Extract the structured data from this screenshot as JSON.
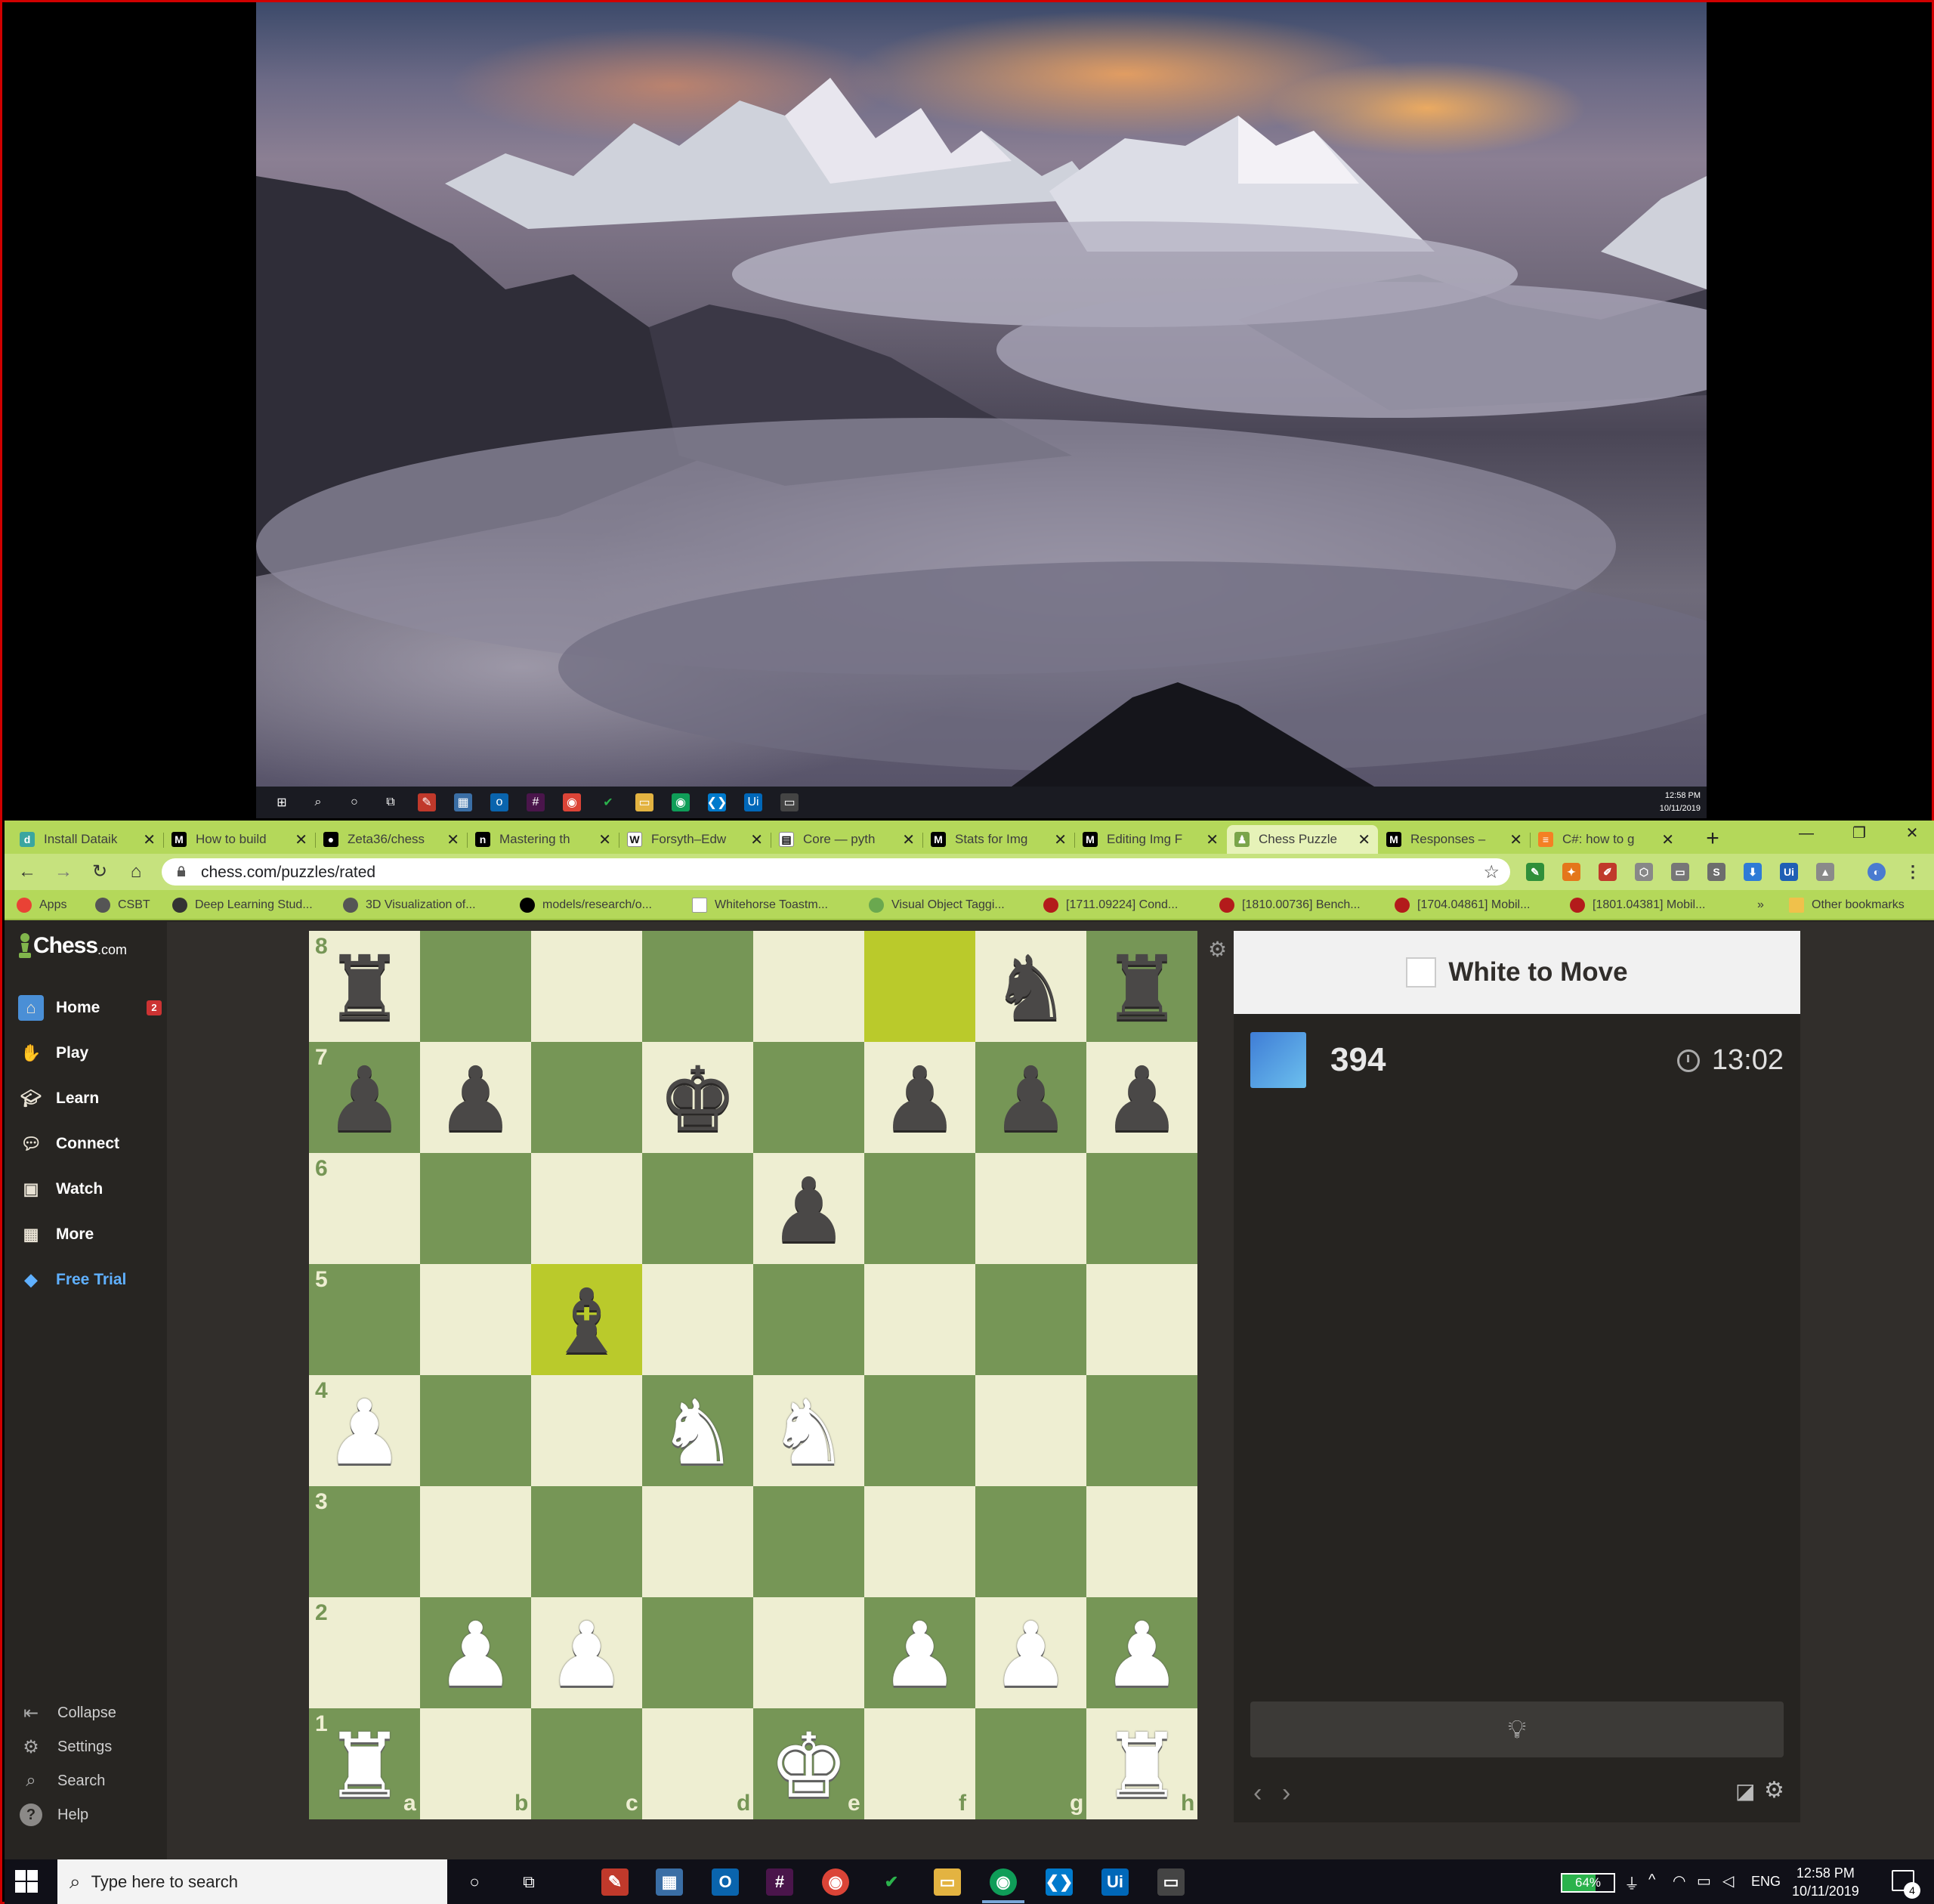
{
  "top_monitor": {
    "taskbar_clock": {
      "time": "12:58 PM",
      "date": "10/11/2019"
    }
  },
  "browser": {
    "tabs": [
      {
        "label": "Install Dataik",
        "icon": "dataiku-icon",
        "color": "#3aa6a0",
        "glyph": "d"
      },
      {
        "label": "How to build",
        "icon": "medium-icon",
        "color": "#000000",
        "glyph": "M"
      },
      {
        "label": "Zeta36/chess",
        "icon": "github-icon",
        "color": "#000000",
        "glyph": "●"
      },
      {
        "label": "Mastering th",
        "icon": "notion-icon",
        "color": "#000000",
        "glyph": "n"
      },
      {
        "label": "Forsyth–Edw",
        "icon": "wikipedia-icon",
        "color": "#ffffff",
        "glyph": "W"
      },
      {
        "label": "Core — pyth",
        "icon": "docs-icon",
        "color": "#ffffff",
        "glyph": "▤"
      },
      {
        "label": "Stats for Img",
        "icon": "medium-icon",
        "color": "#000000",
        "glyph": "M"
      },
      {
        "label": "Editing Img F",
        "icon": "medium-icon",
        "color": "#000000",
        "glyph": "M"
      },
      {
        "label": "Chess Puzzle",
        "icon": "chess-pawn-icon",
        "color": "#7aa54a",
        "glyph": "♟",
        "active": true
      },
      {
        "label": "Responses –",
        "icon": "medium-icon",
        "color": "#000000",
        "glyph": "M"
      },
      {
        "label": "C#: how to g",
        "icon": "stackoverflow-icon",
        "color": "#f48024",
        "glyph": "≡"
      }
    ],
    "new_tab": "+",
    "window_controls": {
      "minimize": "—",
      "restore": "❐",
      "close": "✕"
    },
    "url": "chess.com/puzzles/rated",
    "bookmarks": [
      {
        "label": "Apps",
        "icon": "apps-grid-icon",
        "color": "#e94235"
      },
      {
        "label": "CSBT",
        "icon": "globe-icon",
        "color": "#555555"
      },
      {
        "label": "Deep Learning Stud...",
        "icon": "brain-icon",
        "color": "#333333"
      },
      {
        "label": "3D Visualization of...",
        "icon": "globe-icon",
        "color": "#555555"
      },
      {
        "label": "models/research/o...",
        "icon": "github-icon",
        "color": "#000000"
      },
      {
        "label": "Whitehorse Toastm...",
        "icon": "fth-icon",
        "color": "#ffffff"
      },
      {
        "label": "Visual Object Taggi...",
        "icon": "tag-icon",
        "color": "#6aa84f"
      },
      {
        "label": "[1711.09224] Cond...",
        "icon": "arxiv-icon",
        "color": "#b31b1b"
      },
      {
        "label": "[1810.00736] Bench...",
        "icon": "arxiv-icon",
        "color": "#b31b1b"
      },
      {
        "label": "[1704.04861] Mobil...",
        "icon": "arxiv-icon",
        "color": "#b31b1b"
      },
      {
        "label": "[1801.04381] Mobil...",
        "icon": "arxiv-icon",
        "color": "#b31b1b"
      }
    ],
    "bookmarks_more": "»",
    "other_bookmarks": "Other bookmarks"
  },
  "sidebar": {
    "logo": {
      "main": "Chess",
      "suffix": ".com"
    },
    "items": [
      {
        "label": "Home",
        "icon": "home-icon",
        "badge": "2"
      },
      {
        "label": "Play",
        "icon": "play-icon"
      },
      {
        "label": "Learn",
        "icon": "learn-icon"
      },
      {
        "label": "Connect",
        "icon": "connect-icon"
      },
      {
        "label": "Watch",
        "icon": "watch-icon"
      },
      {
        "label": "More",
        "icon": "more-icon"
      },
      {
        "label": "Free Trial",
        "icon": "diamond-icon"
      }
    ],
    "bottom_items": [
      {
        "label": "Collapse",
        "icon": "collapse-icon"
      },
      {
        "label": "Settings",
        "icon": "gear-icon"
      },
      {
        "label": "Search",
        "icon": "search-icon"
      },
      {
        "label": "Help",
        "icon": "help-icon"
      }
    ]
  },
  "board": {
    "files": [
      "a",
      "b",
      "c",
      "d",
      "e",
      "f",
      "g",
      "h"
    ],
    "ranks": [
      "8",
      "7",
      "6",
      "5",
      "4",
      "3",
      "2",
      "1"
    ],
    "highlighted_squares": [
      "f8",
      "c5"
    ],
    "colors": {
      "light": "#eeeed2",
      "dark": "#769656",
      "highlight_light": "#f6f669",
      "highlight_dark": "#baca2b"
    },
    "pieces": [
      {
        "square": "a8",
        "color": "black",
        "type": "rook",
        "glyph": "♜"
      },
      {
        "square": "g8",
        "color": "black",
        "type": "knight",
        "glyph": "♞"
      },
      {
        "square": "h8",
        "color": "black",
        "type": "rook",
        "glyph": "♜"
      },
      {
        "square": "a7",
        "color": "black",
        "type": "pawn",
        "glyph": "♟"
      },
      {
        "square": "b7",
        "color": "black",
        "type": "pawn",
        "glyph": "♟"
      },
      {
        "square": "d7",
        "color": "black",
        "type": "king",
        "glyph": "♚"
      },
      {
        "square": "f7",
        "color": "black",
        "type": "pawn",
        "glyph": "♟"
      },
      {
        "square": "g7",
        "color": "black",
        "type": "pawn",
        "glyph": "♟"
      },
      {
        "square": "h7",
        "color": "black",
        "type": "pawn",
        "glyph": "♟"
      },
      {
        "square": "e6",
        "color": "black",
        "type": "pawn",
        "glyph": "♟"
      },
      {
        "square": "c5",
        "color": "black",
        "type": "bishop",
        "glyph": "♝"
      },
      {
        "square": "a4",
        "color": "white",
        "type": "pawn",
        "glyph": "♟"
      },
      {
        "square": "d4",
        "color": "white",
        "type": "knight",
        "glyph": "♞"
      },
      {
        "square": "e4",
        "color": "white",
        "type": "knight",
        "glyph": "♞"
      },
      {
        "square": "b2",
        "color": "white",
        "type": "pawn",
        "glyph": "♟"
      },
      {
        "square": "c2",
        "color": "white",
        "type": "pawn",
        "glyph": "♟"
      },
      {
        "square": "f2",
        "color": "white",
        "type": "pawn",
        "glyph": "♟"
      },
      {
        "square": "g2",
        "color": "white",
        "type": "pawn",
        "glyph": "♟"
      },
      {
        "square": "h2",
        "color": "white",
        "type": "pawn",
        "glyph": "♟"
      },
      {
        "square": "a1",
        "color": "white",
        "type": "rook",
        "glyph": "♜"
      },
      {
        "square": "e1",
        "color": "white",
        "type": "king",
        "glyph": "♚"
      },
      {
        "square": "h1",
        "color": "white",
        "type": "rook",
        "glyph": "♜"
      }
    ]
  },
  "puzzle_panel": {
    "title": "White to Move",
    "rating": "394",
    "timer": "13:02",
    "hint_icon": "lightbulb-icon"
  },
  "taskbar": {
    "search_placeholder": "Type here to search",
    "battery": {
      "label": "64%",
      "level": 0.64
    },
    "language": "ENG",
    "time": "12:58 PM",
    "date": "10/11/2019",
    "notifications": "4"
  }
}
